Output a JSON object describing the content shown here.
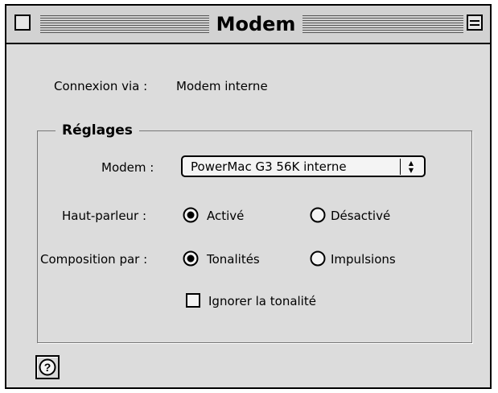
{
  "window": {
    "title": "Modem"
  },
  "connection": {
    "label": "Connexion via :",
    "value": "Modem interne"
  },
  "settings": {
    "group_label": "Réglages",
    "modem": {
      "label": "Modem :",
      "selected": "PowerMac G3 56K interne"
    },
    "speaker": {
      "label": "Haut-parleur :",
      "options": [
        {
          "label": "Activé",
          "selected": true
        },
        {
          "label": "Désactivé",
          "selected": false
        }
      ]
    },
    "dialing": {
      "label": "Composition par :",
      "options": [
        {
          "label": "Tonalités",
          "selected": true
        },
        {
          "label": "Impulsions",
          "selected": false
        }
      ]
    },
    "ignore_dial_tone": {
      "label": "Ignorer la tonalité",
      "checked": false
    }
  },
  "icons": {
    "close": "close-box-icon",
    "zoom": "zoom-box-icon",
    "help": "question-mark-icon",
    "popup": "up-down-arrows-icon",
    "radio_on": "radio-selected-icon",
    "radio_off": "radio-unselected-icon"
  }
}
